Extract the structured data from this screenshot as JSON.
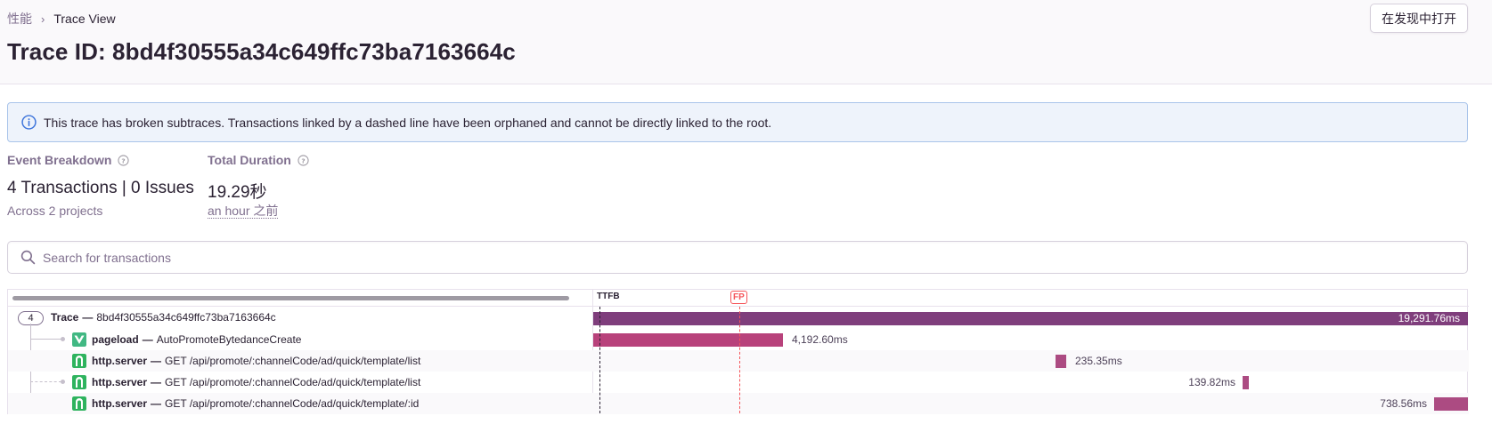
{
  "breadcrumb": {
    "parent": "性能",
    "separator": "›",
    "current": "Trace View"
  },
  "page_title": "Trace ID: 8bd4f30555a34c649ffc73ba7163664c",
  "open_in_discover_label": "在发现中打开",
  "alert": {
    "text": "This trace has broken subtraces. Transactions linked by a dashed line have been orphaned and cannot be directly linked to the root."
  },
  "stats": {
    "event_breakdown": {
      "label": "Event Breakdown",
      "value": "4 Transactions | 0 Issues",
      "sub": "Across 2 projects"
    },
    "total_duration": {
      "label": "Total Duration",
      "value": "19.29秒",
      "sub": "an hour 之前"
    }
  },
  "search": {
    "placeholder": "Search for transactions",
    "value": ""
  },
  "trace_view": {
    "markers": {
      "ttfb": "TTFB",
      "fp": "FP"
    },
    "root": {
      "count": "4",
      "op": "Trace",
      "description": "8bd4f30555a34c649ffc73ba7163664c",
      "duration": "19,291.76ms",
      "bar_fraction": 1.0
    },
    "transactions": [
      {
        "op": "pageload",
        "description": "AutoPromoteBytedanceCreate",
        "duration": "4,192.60ms",
        "project_icon": "vue-icon"
      },
      {
        "op": "http.server",
        "description": "GET /api/promote/:channelCode/ad/quick/template/list",
        "duration": "235.35ms",
        "project_icon": "python-icon"
      },
      {
        "op": "http.server",
        "description": "GET /api/promote/:channelCode/ad/quick/template/list",
        "duration": "139.82ms",
        "project_icon": "python-icon"
      },
      {
        "op": "http.server",
        "description": "GET /api/promote/:channelCode/ad/quick/template/:id",
        "duration": "738.56ms",
        "project_icon": "python-icon"
      }
    ]
  },
  "colors": {
    "root_bar": "#7f3e7c",
    "pageload_bar": "#b8427b",
    "server_bar": "#ac4b82",
    "vue_green": "#41b883",
    "python_green": "#2eb35e",
    "fp_red": "#f55459"
  }
}
